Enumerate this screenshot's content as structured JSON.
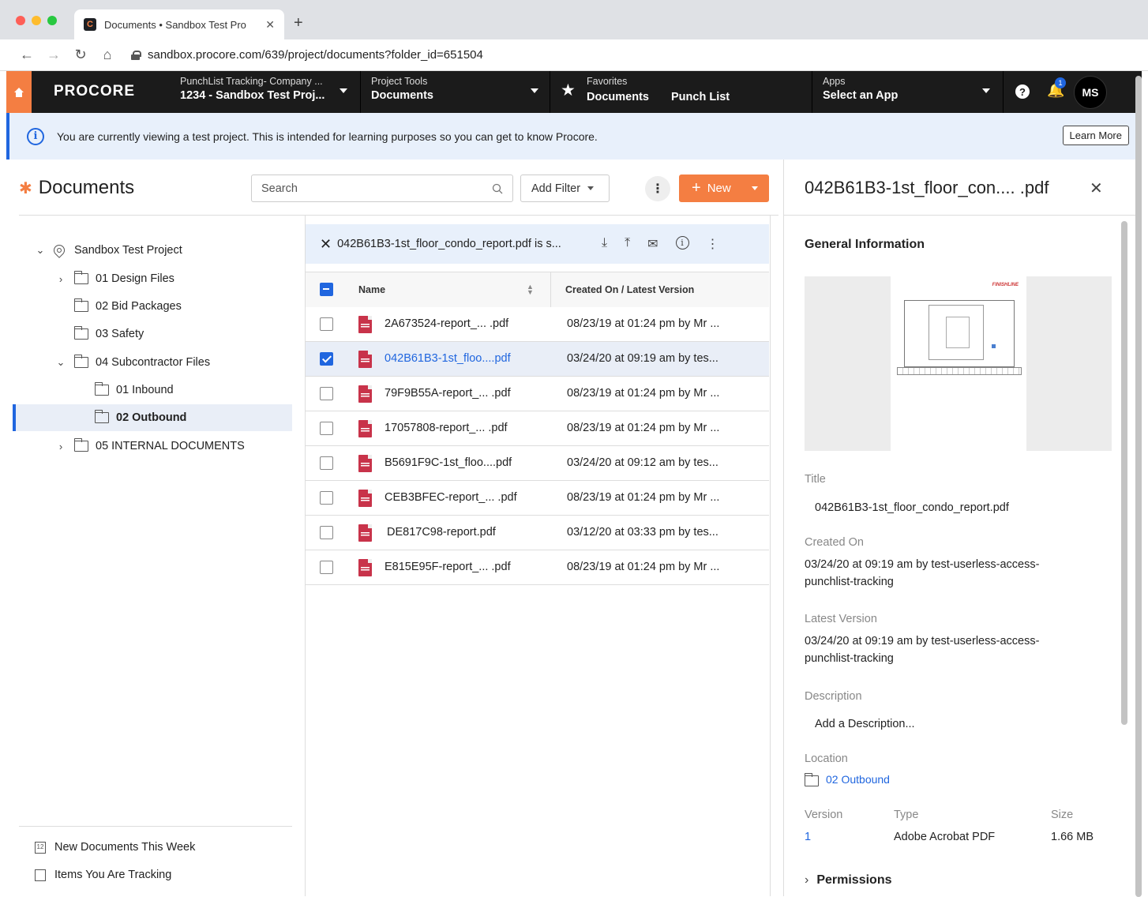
{
  "browser": {
    "tab_title": "Documents • Sandbox Test Pro",
    "url": "sandbox.procore.com/639/project/documents?folder_id=651504"
  },
  "header": {
    "logo": "PROCORE",
    "company_small": "PunchList Tracking- Company ...",
    "project_large": "1234 - Sandbox Test Proj...",
    "tools_small": "Project Tools",
    "tools_large": "Documents",
    "favorites_small": "Favorites",
    "favorites": [
      "Documents",
      "Punch List"
    ],
    "apps_small": "Apps",
    "apps_large": "Select an App",
    "notification_count": "1",
    "avatar_initials": "MS"
  },
  "banner": {
    "text": "You are currently viewing a test project. This is intended for learning purposes so you can get to know Procore.",
    "button": "Learn More"
  },
  "toolbar": {
    "title": "Documents",
    "search_placeholder": "Search",
    "filter_label": "Add Filter",
    "new_label": "New"
  },
  "tree": {
    "root": "Sandbox Test Project",
    "items": [
      "01 Design Files",
      "02 Bid Packages",
      "03 Safety",
      "04 Subcontractor Files",
      "01 Inbound",
      "02 Outbound",
      "05 INTERNAL DOCUMENTS"
    ]
  },
  "footer_links": [
    "New Documents This Week",
    "Items You Are Tracking"
  ],
  "selection_bar": {
    "text": "042B61B3-1st_floor_condo_report.pdf is s..."
  },
  "table": {
    "columns": [
      "Name",
      "Created On / Latest Version"
    ],
    "rows": [
      {
        "name": "2A673524-report_... .pdf",
        "date": "08/23/19 at 01:24 pm by Mr ..."
      },
      {
        "name": "042B61B3-1st_floo....pdf",
        "date": "03/24/20 at 09:19 am by tes..."
      },
      {
        "name": "79F9B55A-report_... .pdf",
        "date": "08/23/19 at 01:24 pm by Mr ..."
      },
      {
        "name": "17057808-report_... .pdf",
        "date": "08/23/19 at 01:24 pm by Mr ..."
      },
      {
        "name": "B5691F9C-1st_floo....pdf",
        "date": "03/24/20 at 09:12 am by tes..."
      },
      {
        "name": "CEB3BFEC-report_... .pdf",
        "date": "08/23/19 at 01:24 pm by Mr ..."
      },
      {
        "name": "DE817C98-report.pdf",
        "date": "03/12/20 at 03:33 pm by tes..."
      },
      {
        "name": "E815E95F-report_... .pdf",
        "date": "08/23/19 at 01:24 pm by Mr ..."
      }
    ]
  },
  "detail": {
    "title": "042B61B3-1st_floor_con.... .pdf",
    "section": "General Information",
    "preview_brand": "FINISHLINE",
    "title_label": "Title",
    "title_value": "042B61B3-1st_floor_condo_report.pdf",
    "created_label": "Created On",
    "created_value": "03/24/20 at 09:19 am by test-userless-access-punchlist-tracking",
    "latest_label": "Latest Version",
    "latest_value": "03/24/20 at 09:19 am by test-userless-access-punchlist-tracking",
    "description_label": "Description",
    "description_placeholder": "Add a Description...",
    "location_label": "Location",
    "location_value": "02 Outbound",
    "version_label": "Version",
    "version_value": "1",
    "type_label": "Type",
    "type_value": "Adobe Acrobat PDF",
    "size_label": "Size",
    "size_value": "1.66 MB",
    "permissions": "Permissions"
  },
  "colors": {
    "accent": "#f47e42",
    "link": "#2066df",
    "header_bg": "#1b1b1b"
  }
}
